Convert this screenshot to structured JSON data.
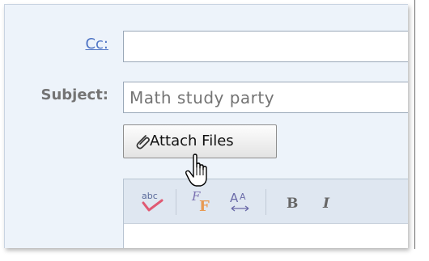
{
  "labels": {
    "cc": "Cc:",
    "subject": "Subject:"
  },
  "fields": {
    "cc_value": "",
    "subject_value": "Math study party"
  },
  "attach": {
    "label": "Attach Files"
  },
  "toolbar": {
    "bold": "B",
    "italic": "I"
  }
}
